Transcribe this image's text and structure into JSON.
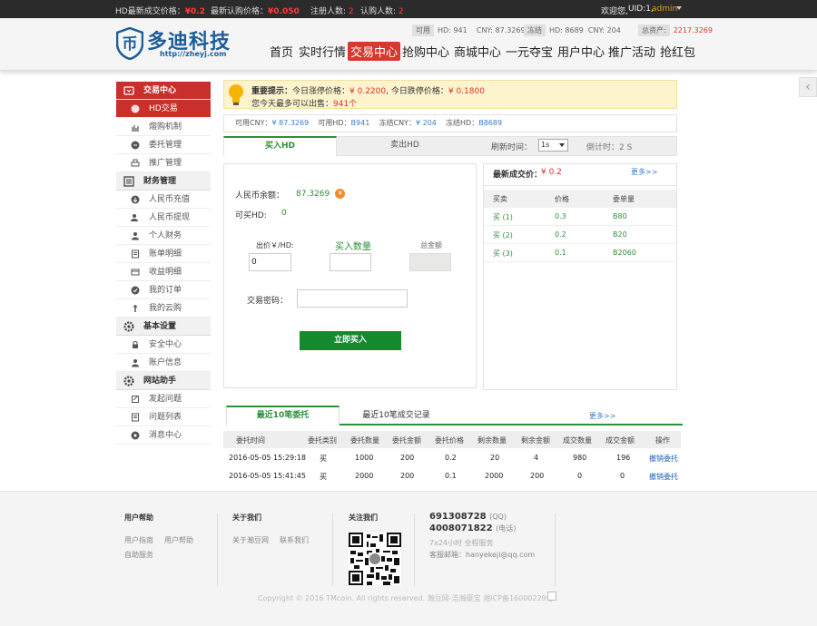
{
  "topbar": {
    "last_price_label": "HD最新成交价格：",
    "last_price": "¥0.2",
    "subscribe_price_label": "最新认购价格：",
    "subscribe_price": "¥0.050",
    "registered_label": "注册人数:",
    "registered": "2",
    "subscribers_label": "认购人数:",
    "subscribers": "2",
    "welcome": "欢迎您,",
    "uid": "UID:1,",
    "username": "admin"
  },
  "header": {
    "logo_text": "多迪科技",
    "logo_url": "http://zheyj.com",
    "available_tag": "可用",
    "available_hd": "HD: 941",
    "available_cny": "CNY: 87.3269",
    "frozen_tag": "冻结",
    "frozen_hd": "HD: 8689",
    "frozen_cny": "CNY: 204",
    "total_tag": "总资产:",
    "total_value": "2217.3269"
  },
  "nav": [
    "首页",
    "实时行情",
    "交易中心",
    "抢购中心",
    "商城中心",
    "一元夺宝",
    "用户中心",
    "推广活动",
    "抢红包"
  ],
  "sidebar": {
    "sections": [
      {
        "title": "交易中心",
        "items": [
          "HD交易",
          "熔购机制",
          "委托管理",
          "推广管理"
        ]
      },
      {
        "title": "财务管理",
        "items": [
          "人民币充值",
          "人民币提现",
          "个人财务",
          "账单明细",
          "收益明细",
          "我的订单",
          "我的云购"
        ]
      },
      {
        "title": "基本设置",
        "items": [
          "安全中心",
          "账户信息"
        ]
      },
      {
        "title": "网站助手",
        "items": [
          "发起问题",
          "问题列表",
          "消息中心"
        ]
      }
    ]
  },
  "notice": {
    "title": "重要提示：",
    "limit_up_label": "今日涨停价格：",
    "limit_up": "¥ 0.2200",
    "limit_down_label": "今日跌停价格：",
    "limit_down": "¥ 0.1800",
    "max_sell_label": "您今天最多可以出售：",
    "max_sell": "941个"
  },
  "balances": {
    "cny_label": "可用CNY：",
    "cny": "¥ 87.3269",
    "hd_label": "可用HD：",
    "hd": "B941",
    "frozen_cny_label": "冻结CNY：",
    "frozen_cny": "¥ 204",
    "frozen_hd_label": "冻结HD：",
    "frozen_hd": "B8689"
  },
  "trade_tabs": {
    "buy": "买入HD",
    "sell": "卖出HD",
    "refresh_label": "刷新时间：",
    "refresh_value": "1s",
    "countdown_label": "倒计时：",
    "countdown_value": "2 S"
  },
  "buy_form": {
    "cny_balance_label": "人民币余额：",
    "cny_balance": "87.3269",
    "cny_badge": "¥",
    "can_buy_label": "可买HD:",
    "can_buy": "0",
    "price_label": "出价￥/HD:",
    "price_value": "0",
    "qty_label": "买入数量",
    "qty_value": "",
    "total_label": "总金额",
    "total_value": "",
    "password_label": "交易密码：",
    "password_value": "",
    "submit": "立即买入"
  },
  "order_book": {
    "latest_label": "最新成交价：",
    "latest_value": "¥ 0.2",
    "more": "更多>>",
    "columns": [
      "买卖",
      "价格",
      "委单量"
    ],
    "rows": [
      {
        "side": "买 (1)",
        "price": "0.3",
        "qty": "B80"
      },
      {
        "side": "买 (2)",
        "price": "0.2",
        "qty": "B20"
      },
      {
        "side": "买 (3)",
        "price": "0.1",
        "qty": "B2060"
      }
    ]
  },
  "orders": {
    "tab_active": "最近10笔委托",
    "tab_other": "最近10笔成交记录",
    "more": "更多>>",
    "columns": [
      "委托时间",
      "委托类别",
      "委托数量",
      "委托金额",
      "委托价格",
      "剩余数量",
      "剩余金额",
      "成交数量",
      "成交金额",
      "操作"
    ],
    "rows": [
      [
        "2016-05-05 15:29:18",
        "买",
        "1000",
        "200",
        "0.2",
        "20",
        "4",
        "980",
        "196",
        "撤销委托"
      ],
      [
        "2016-05-05 15:41:45",
        "买",
        "2000",
        "200",
        "0.1",
        "2000",
        "200",
        "0",
        "0",
        "撤销委托"
      ]
    ]
  },
  "footer": {
    "help_title": "用户帮助",
    "help_links": [
      "用户指南",
      "用户帮助",
      "自助服务"
    ],
    "about_title": "关于我们",
    "about_links": [
      "关于瀚豆网",
      "联系我们"
    ],
    "follow_title": "关注我们",
    "qq1": "691308728",
    "qq_tag": "(QQ)",
    "phone": "4008071822",
    "phone_tag": "(电话)",
    "service": "7x24小时 全程服务",
    "email": "客服邮箱：hanyekeji@qq.com",
    "copyright": "Copyright © 2016 TMcoin. All rights reserved. 瀚豆网-浩瀚豪宝 湘ICP备16000229号"
  }
}
